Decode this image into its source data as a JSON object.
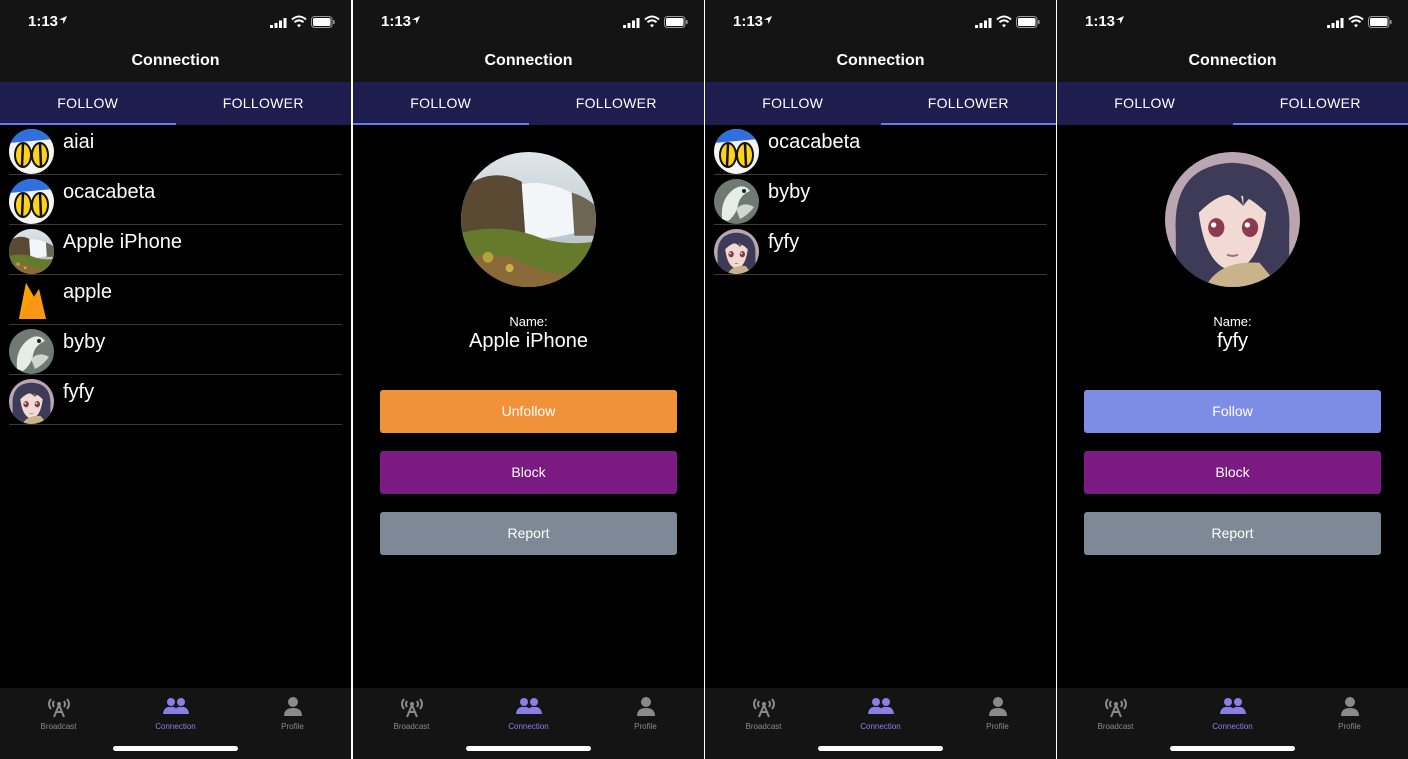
{
  "status": {
    "time": "1:13"
  },
  "colors": {
    "tab_bg": "#1e1d4e",
    "tab_indicator": "#5b7ff0",
    "unfollow": "#f0923a",
    "follow": "#7d8de6",
    "block": "#7a1a82",
    "report": "#7d8996",
    "active_tab_icon": "#8b7fe6"
  },
  "nav": {
    "title": "Connection"
  },
  "tabs": {
    "follow": "FOLLOW",
    "follower": "FOLLOWER"
  },
  "tabbar": {
    "broadcast": "Broadcast",
    "connection": "Connection",
    "profile": "Profile"
  },
  "screens": {
    "s1": {
      "active_tab": "follow",
      "list": [
        {
          "name": "aiai",
          "avatar": "yellow-eyes-character"
        },
        {
          "name": "ocacabeta",
          "avatar": "yellow-eyes-character"
        },
        {
          "name": "Apple iPhone",
          "avatar": "waterfall-landscape"
        },
        {
          "name": "apple",
          "avatar": "firebase-flame"
        },
        {
          "name": "byby",
          "avatar": "bird-sculpture"
        },
        {
          "name": "fyfy",
          "avatar": "anime-girl"
        }
      ]
    },
    "s2": {
      "active_tab": "follow",
      "detail": {
        "label": "Name:",
        "name": "Apple iPhone",
        "avatar": "waterfall-landscape",
        "primary_button": "Unfollow",
        "block_button": "Block",
        "report_button": "Report"
      }
    },
    "s3": {
      "active_tab": "follower",
      "list": [
        {
          "name": "ocacabeta",
          "avatar": "yellow-eyes-character"
        },
        {
          "name": "byby",
          "avatar": "bird-sculpture"
        },
        {
          "name": "fyfy",
          "avatar": "anime-girl"
        }
      ]
    },
    "s4": {
      "active_tab": "follower",
      "detail": {
        "label": "Name:",
        "name": "fyfy",
        "avatar": "anime-girl",
        "primary_button": "Follow",
        "block_button": "Block",
        "report_button": "Report"
      }
    }
  }
}
